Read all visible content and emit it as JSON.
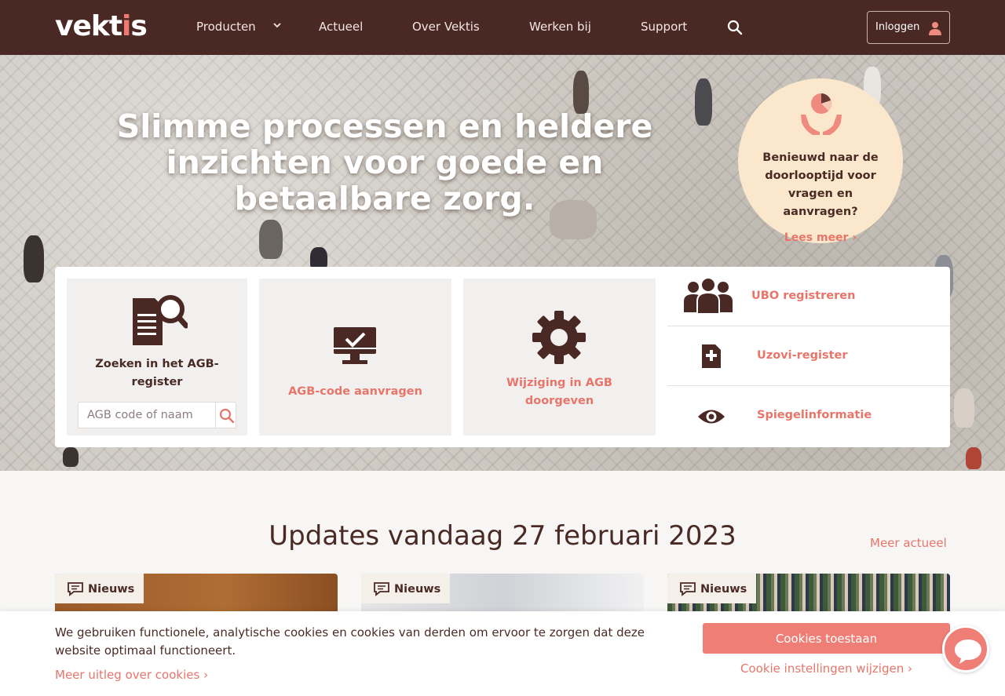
{
  "nav": {
    "logo_main": "vekt",
    "logo_i": "i",
    "logo_end": "s",
    "items": [
      "Producten",
      "Actueel",
      "Over Vektis",
      "Werken bij",
      "Support"
    ],
    "login_label": "Inloggen"
  },
  "hero": {
    "title": "Slimme processen en heldere inzichten voor goede en betaalbare zorg.",
    "bubble_text": "Benieuwd naar de doorlooptijd voor vragen en aanvragen?",
    "bubble_link": "Lees meer"
  },
  "tiles": {
    "search_label": "Zoeken in het AGB-register",
    "search_placeholder": "AGB code of naam",
    "request_label": "AGB-code aanvragen",
    "change_label": "Wijziging in AGB doorgeven"
  },
  "links": [
    "UBO registreren",
    "Uzovi-register",
    "Spiegelinformatie"
  ],
  "updates": {
    "title": "Updates vandaag 27 februari 2023",
    "more": "Meer actueel",
    "badge": "Nieuws"
  },
  "cookie": {
    "text": "We gebruiken functionele, analytische cookies en cookies van derden om ervoor te zorgen dat deze website optimaal functioneert.",
    "link": "Meer uitleg over cookies",
    "accept": "Cookies toestaan",
    "settings": "Cookie instellingen wijzigen"
  },
  "colors": {
    "brand_dark": "#4a2824",
    "accent": "#e8756a",
    "bubble": "#fbe8cc"
  },
  "icons": [
    "chevron-down-icon",
    "search-icon",
    "user-icon",
    "hands-chart-icon",
    "document-search-icon",
    "monitor-check-icon",
    "gear-icon",
    "group-icon",
    "document-plus-icon",
    "eye-icon",
    "chat-bubble-icon"
  ]
}
